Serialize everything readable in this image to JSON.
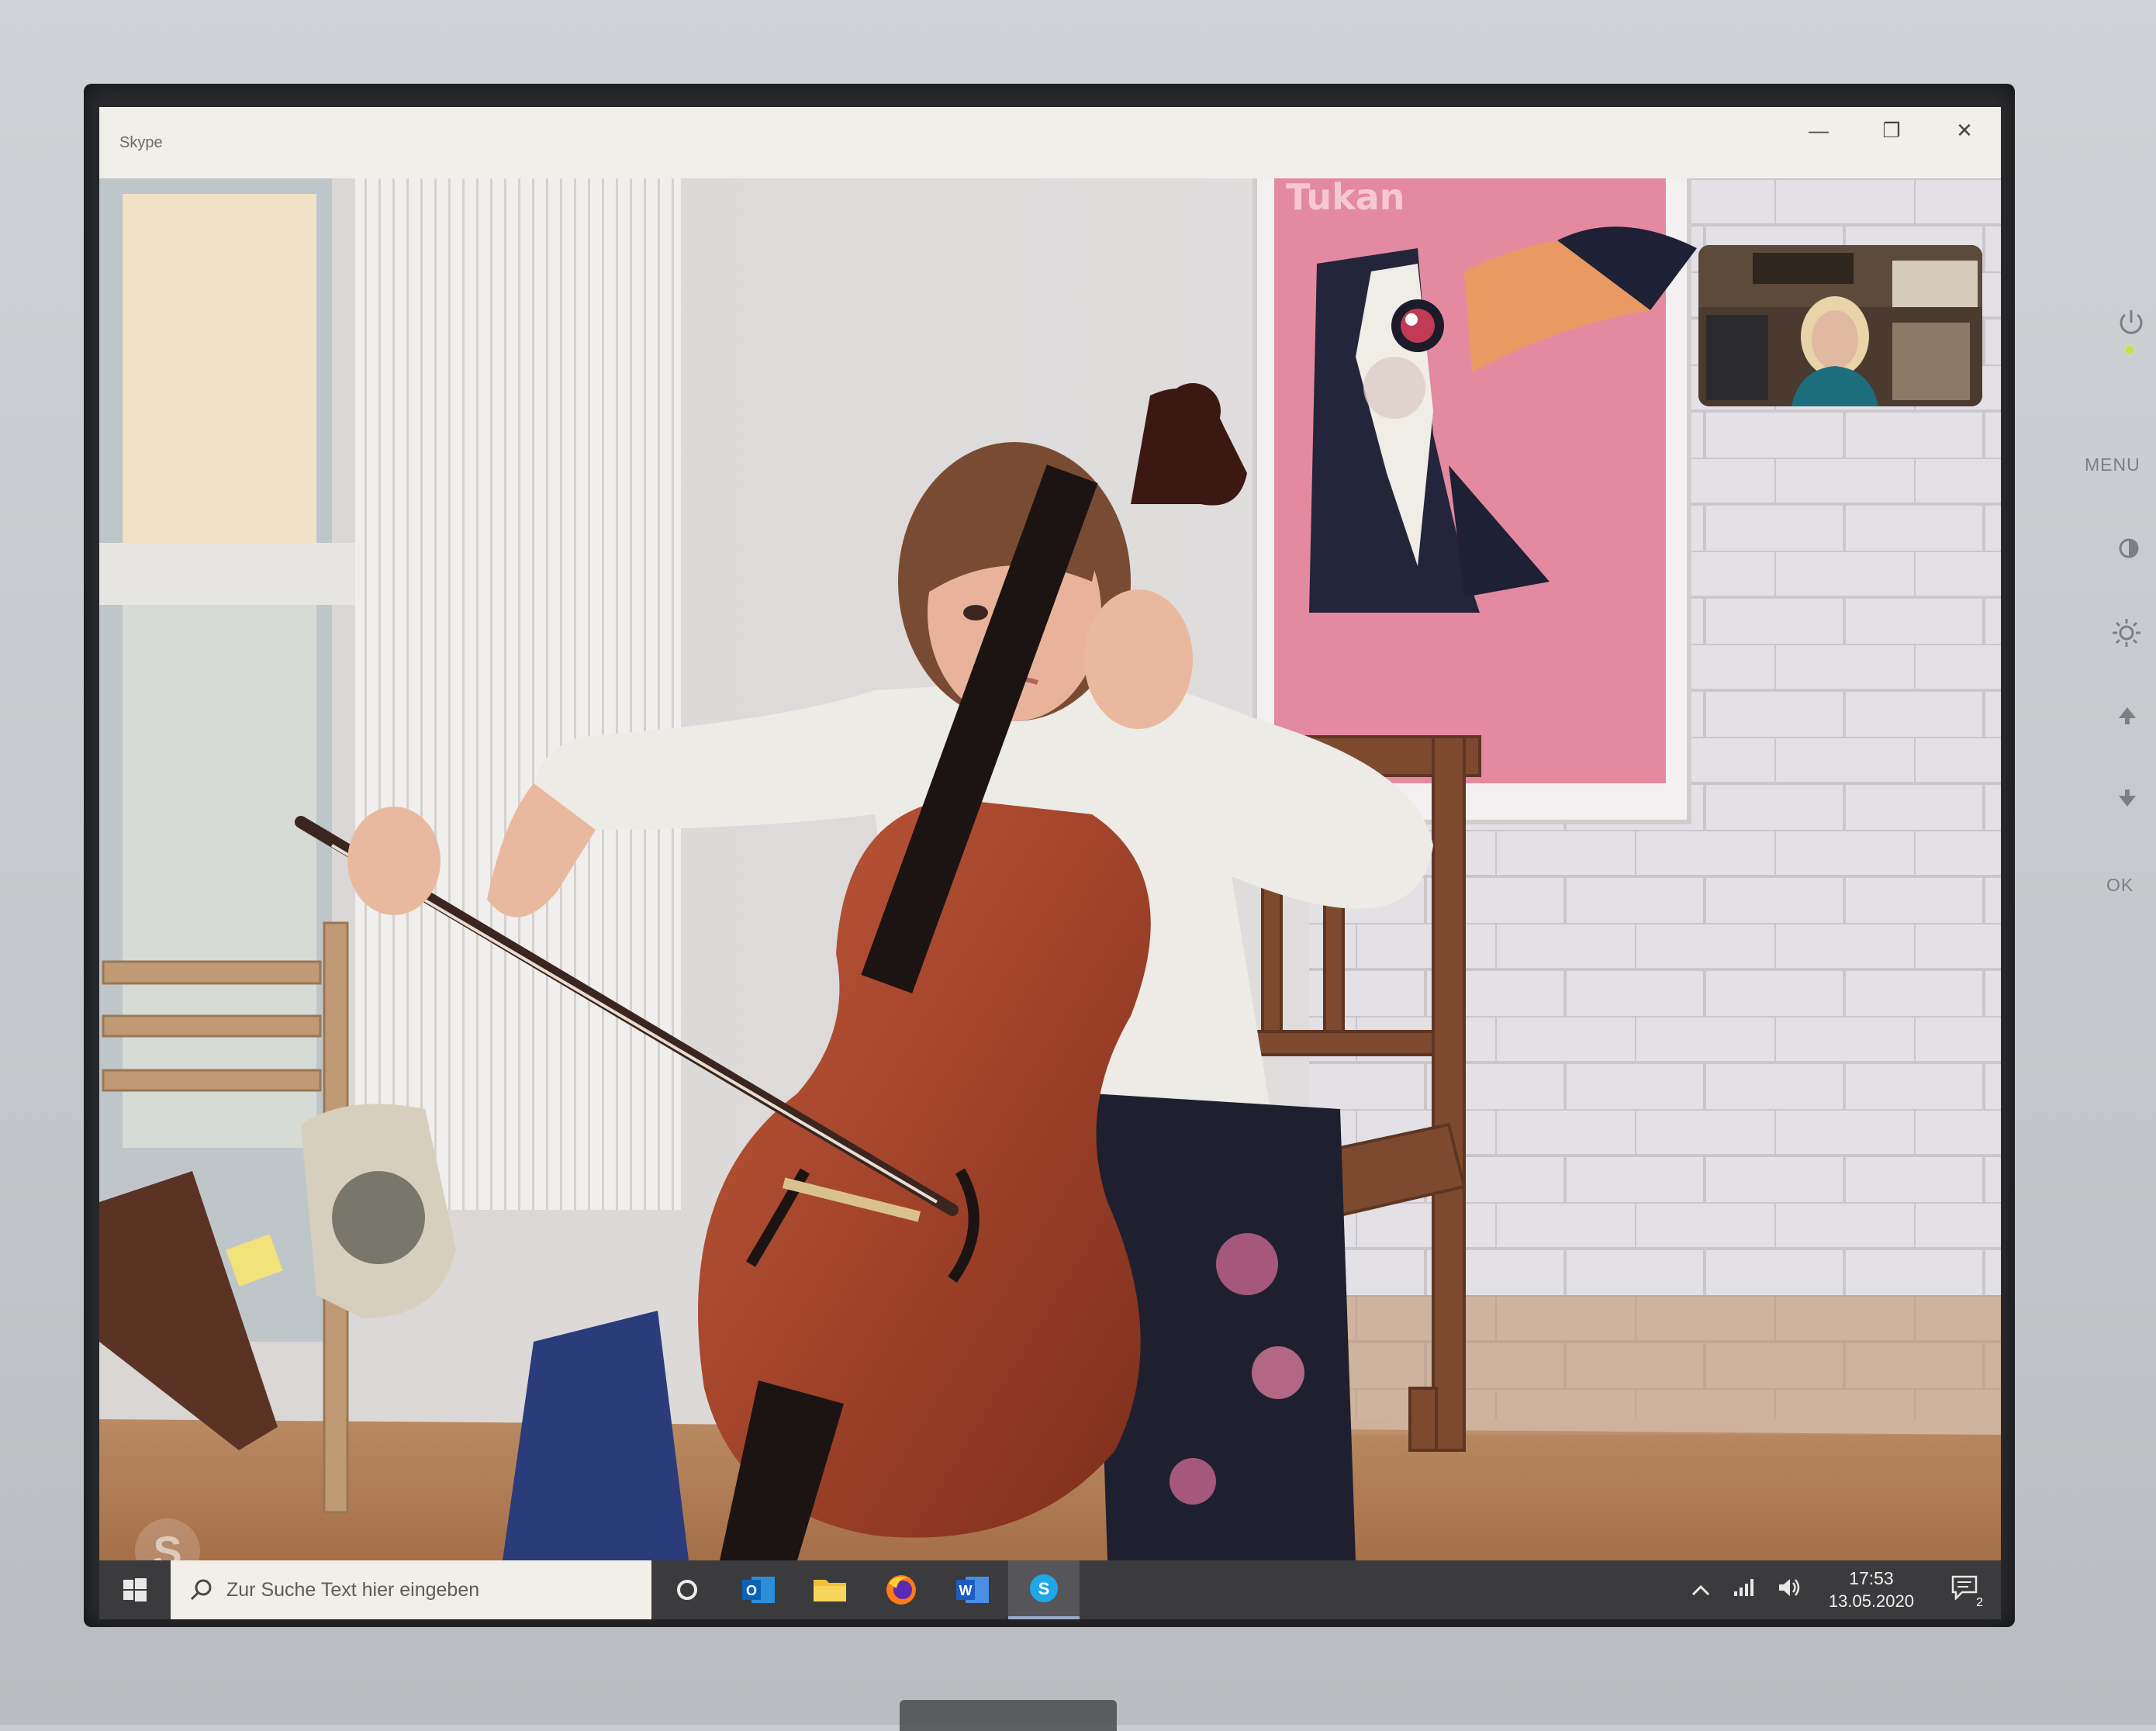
{
  "window": {
    "app_title": "Skype",
    "minimize_glyph": "—",
    "maximize_glyph": "❐",
    "close_glyph": "✕"
  },
  "video": {
    "poster_text": "Tukan",
    "watermark_glyph": "S"
  },
  "taskbar": {
    "search_placeholder": "Zur Suche Text hier eingeben",
    "apps": [
      "task-view",
      "outlook",
      "file-explorer",
      "firefox",
      "word",
      "skype"
    ],
    "word_letter": "W",
    "outlook_letter": "O",
    "skype_letter": "S",
    "time": "17:53",
    "date": "13.05.2020",
    "notifications_count": "2"
  },
  "monitor": {
    "menu_label": "MENU",
    "ok_label": "OK",
    "icons": [
      "power-icon",
      "contrast-icon",
      "brightness-icon",
      "up-icon",
      "down-icon"
    ]
  },
  "colors": {
    "taskbar": "#3b3a3c",
    "titlebar": "#f1efe9",
    "poster_pink": "#e48aa0",
    "cello": "#a1432a",
    "power_led": "#c8e04a"
  }
}
